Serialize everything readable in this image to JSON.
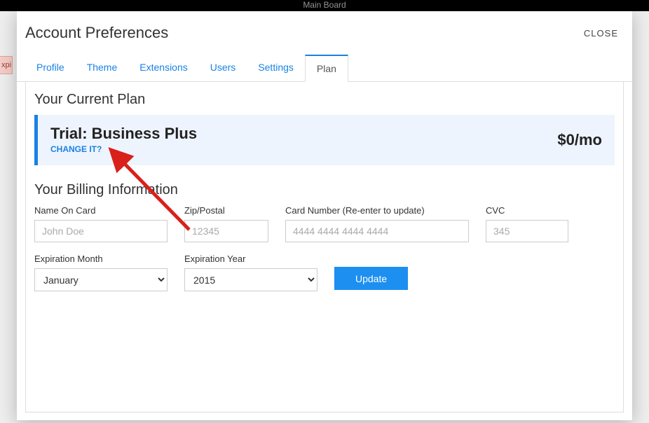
{
  "topbar": {
    "title": "Main Board"
  },
  "bg_banner": {
    "text": "xpi"
  },
  "modal": {
    "title": "Account Preferences",
    "close_label": "CLOSE"
  },
  "tabs": [
    {
      "label": "Profile",
      "active": false
    },
    {
      "label": "Theme",
      "active": false
    },
    {
      "label": "Extensions",
      "active": false
    },
    {
      "label": "Users",
      "active": false
    },
    {
      "label": "Settings",
      "active": false
    },
    {
      "label": "Plan",
      "active": true
    }
  ],
  "plan": {
    "section_title": "Your Current Plan",
    "name": "Trial: Business Plus",
    "change_label": "CHANGE IT?",
    "price": "$0/mo"
  },
  "billing": {
    "section_title": "Your Billing Information",
    "name_label": "Name On Card",
    "name_placeholder": "John Doe",
    "zip_label": "Zip/Postal",
    "zip_placeholder": "12345",
    "card_label": "Card Number (Re-enter to update)",
    "card_placeholder": "4444 4444 4444 4444",
    "cvc_label": "CVC",
    "cvc_placeholder": "345",
    "month_label": "Expiration Month",
    "month_value": "January",
    "year_label": "Expiration Year",
    "year_value": "2015",
    "update_label": "Update"
  }
}
